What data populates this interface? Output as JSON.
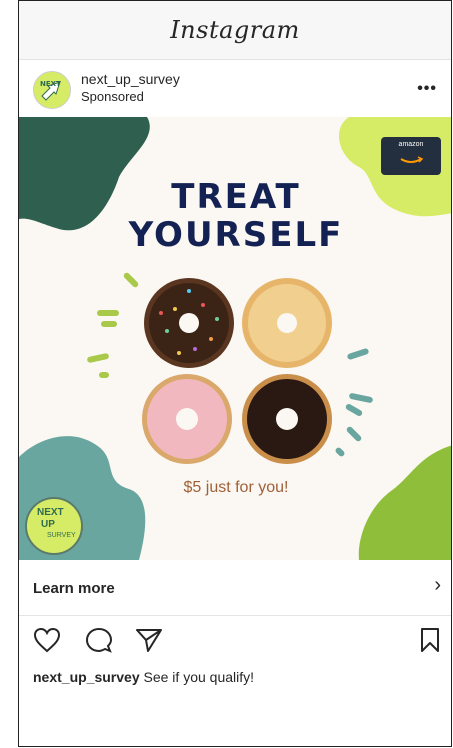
{
  "app": {
    "logo_text": "Instagram"
  },
  "post": {
    "username": "next_up_survey",
    "sponsored_label": "Sponsored",
    "more_label": "•••"
  },
  "ad": {
    "headline_line1": "TREAT",
    "headline_line2": "YOURSELF",
    "subline": "$5 just for you!",
    "giftcard_brand": "amazon",
    "badge_line1": "NEXT",
    "badge_line2": "UP",
    "badge_line3": "SURVEY",
    "colors": {
      "dark_green": "#2f5f4e",
      "lime": "#d7ec66",
      "teal": "#6aa6a0",
      "navy": "#132153",
      "brown": "#a0613a",
      "olive_green": "#8fbf3a"
    }
  },
  "cta": {
    "label": "Learn more",
    "chevron": "›"
  },
  "actions": {
    "icons": [
      "heart-icon",
      "comment-icon",
      "share-icon",
      "bookmark-icon"
    ]
  },
  "caption": {
    "username": "next_up_survey",
    "text": "See if you qualify!"
  }
}
